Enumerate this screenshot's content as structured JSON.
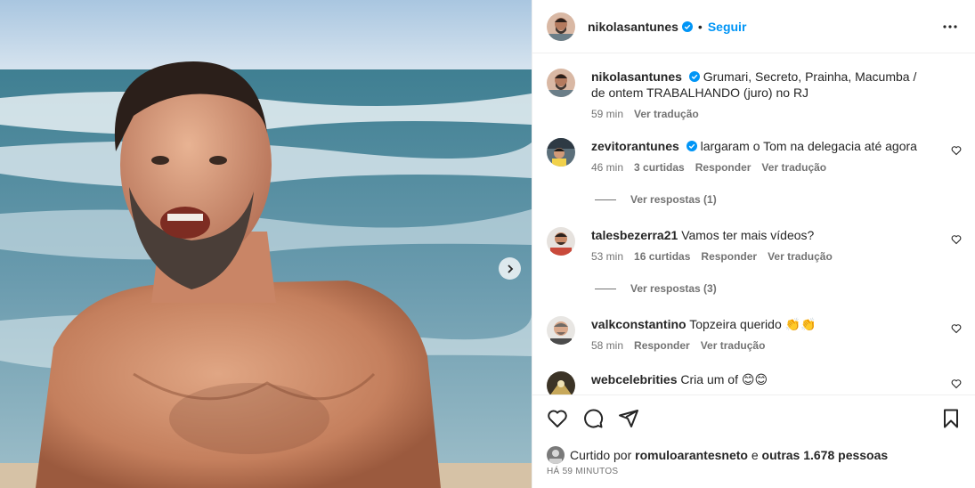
{
  "post": {
    "author": "nikolasantunes",
    "follow_label": "Seguir",
    "separator": "•",
    "caption": "Grumari, Secreto, Prainha, Macumba / de ontem TRABALHANDO (juro) no RJ",
    "caption_time": "59 min",
    "translate_label": "Ver tradução"
  },
  "comments": [
    {
      "user": "zevitorantunes",
      "verified": true,
      "text": "largaram o Tom na delegacia até agora",
      "time": "46 min",
      "likes": "3 curtidas",
      "reply_label": "Responder",
      "translate_label": "Ver tradução",
      "replies": "Ver respostas (1)"
    },
    {
      "user": "talesbezerra21",
      "verified": false,
      "text": "Vamos ter mais vídeos?",
      "time": "53 min",
      "likes": "16 curtidas",
      "reply_label": "Responder",
      "translate_label": "Ver tradução",
      "replies": "Ver respostas (3)"
    },
    {
      "user": "valkconstantino",
      "verified": false,
      "text": "Topzeira querido 👏👏",
      "time": "58 min",
      "reply_label": "Responder",
      "translate_label": "Ver tradução"
    },
    {
      "user": "webcelebrities",
      "verified": false,
      "text": "Cria um of 😊😊"
    }
  ],
  "likes_bar": {
    "prefix": "Curtido por",
    "liker": "romuloarantesneto",
    "joiner": "e",
    "others": "outras 1.678 pessoas"
  },
  "timestamp": "HÁ 59 MINUTOS",
  "icons": {
    "next": "chevron-right-icon",
    "more": "more-options-icon",
    "like": "heart-icon",
    "comment": "comment-icon",
    "share": "send-icon",
    "save": "bookmark-icon",
    "verified": "verified-badge-icon"
  },
  "colors": {
    "accent": "#0095f6",
    "verified": "#0095f6",
    "secondary_text": "#737373",
    "divider": "#efefef"
  }
}
